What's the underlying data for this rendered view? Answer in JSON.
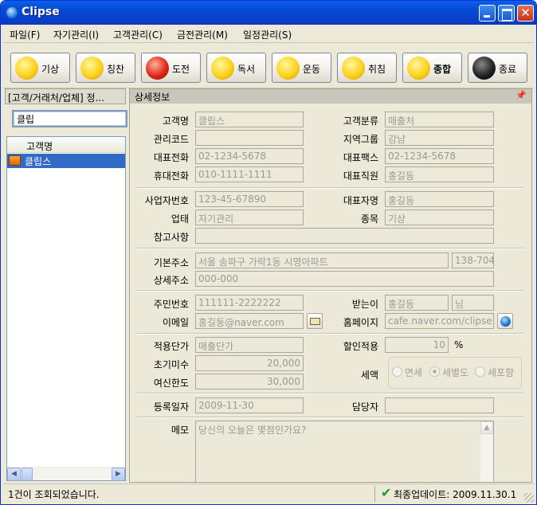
{
  "window": {
    "title": "Clipse"
  },
  "menu": [
    "파일(F)",
    "자기관리(I)",
    "고객관리(C)",
    "금전관리(M)",
    "일정관리(S)"
  ],
  "toolbar": [
    "기상",
    "칭찬",
    "도전",
    "독서",
    "운동",
    "취침",
    "종합",
    "종료"
  ],
  "left": {
    "header": "[고객/거래처/업체] 정...",
    "search_value": "클립",
    "column": "고객명",
    "rows": [
      "클립스"
    ]
  },
  "detail": {
    "header": "상세정보",
    "labels": {
      "name": "고객명",
      "category": "고객분류",
      "code": "관리코드",
      "region": "지역그룹",
      "tel": "대표전화",
      "fax": "대표팩스",
      "mobile": "휴대전화",
      "staff": "대표직원",
      "bizno": "사업자번호",
      "ceo": "대표자명",
      "biztype": "업태",
      "item": "종목",
      "ref": "참고사항",
      "addr": "기본주소",
      "addr2": "상세주소",
      "rrn": "주민번호",
      "recipient": "받는이",
      "email": "이메일",
      "homepage": "홈페이지",
      "price": "적용단가",
      "discount": "할인적용",
      "unpaid": "초기미수",
      "credit": "여신한도",
      "tax": "세액",
      "regdate": "등록일자",
      "manager": "담당자",
      "memo": "메모"
    },
    "values": {
      "name": "클립스",
      "category": "매출처",
      "code": "",
      "region": "강남",
      "tel": "02-1234-5678",
      "fax": "02-1234-5678",
      "mobile": "010-1111-1111",
      "staff": "홍길동",
      "bizno": "123-45-67890",
      "ceo": "홍길동",
      "biztype": "자기관리",
      "item": "기상",
      "ref": "",
      "addr": "서울 송파구 가락1동 시영아파트",
      "zip": "138-704",
      "addr2": "000-000",
      "rrn": "111111-2222222",
      "recipient": "홍길동",
      "honorific": "님",
      "email": "홍길동@naver.com",
      "homepage": "cafe.naver.com/clipse",
      "price": "매출단가",
      "discount": "10",
      "discount_unit": "%",
      "unpaid": "20,000",
      "credit": "30,000",
      "regdate": "2009-11-30",
      "manager": "",
      "memo": "당신의 오늘은 몇점인가요?"
    },
    "tax_options": [
      "면세",
      "세별도",
      "세포함"
    ],
    "tax_selected": "세별도"
  },
  "status": {
    "left": "1건이 조회되었습니다.",
    "right": "최종업데이트: 2009.11.30.1"
  }
}
